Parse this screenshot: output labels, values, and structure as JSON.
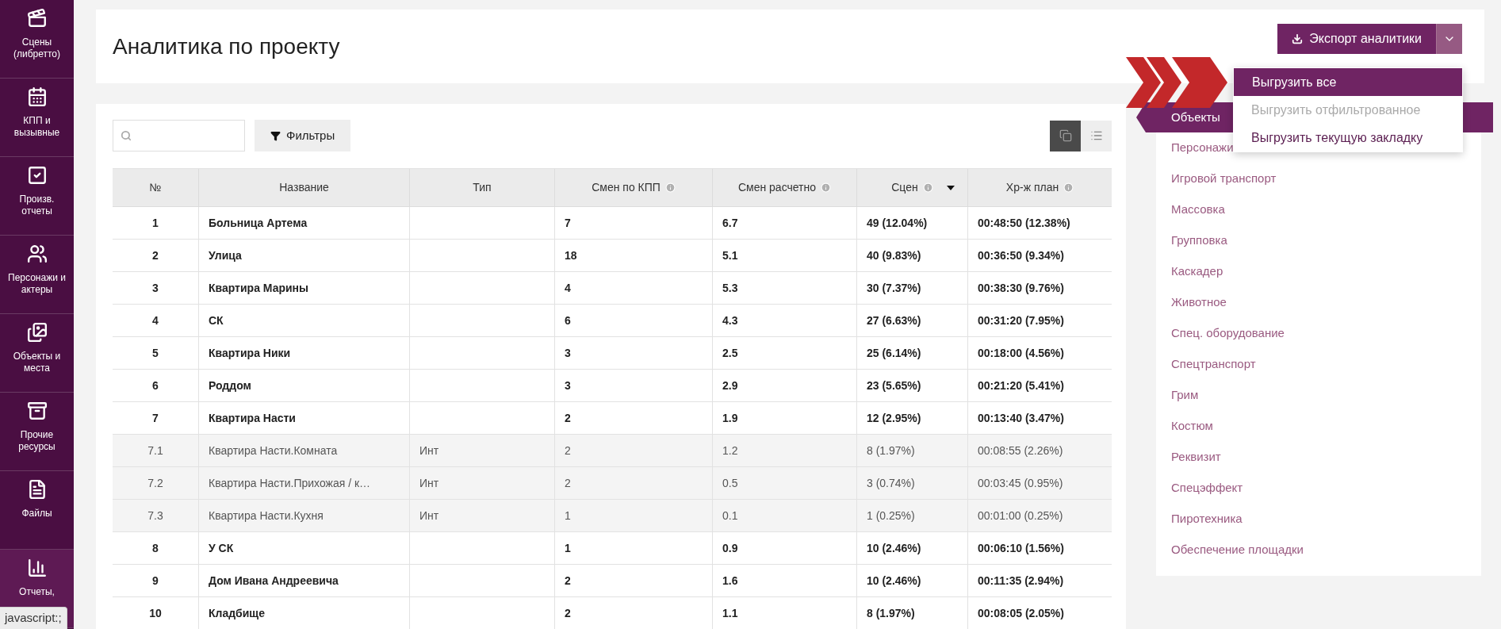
{
  "sidebar": {
    "items": [
      {
        "label": "Сцены (либретто)",
        "selected": false
      },
      {
        "label": "КПП и вызывные",
        "selected": false
      },
      {
        "label": "Произв. отчеты",
        "selected": false
      },
      {
        "label": "Персонажи и актеры",
        "selected": false
      },
      {
        "label": "Объекты и места",
        "selected": false
      },
      {
        "label": "Прочие ресурсы",
        "selected": false
      },
      {
        "label": "Файлы",
        "selected": false
      },
      {
        "label": "Отчеты,",
        "selected": true
      }
    ]
  },
  "header": {
    "title": "Аналитика по проекту",
    "export_button": "Экспорт аналитики"
  },
  "export_menu": {
    "items": [
      {
        "label": "Выгрузить все",
        "selected": true,
        "disabled": false
      },
      {
        "label": "Выгрузить отфильтрованное",
        "selected": false,
        "disabled": true
      },
      {
        "label": "Выгрузить текущую закладку",
        "selected": false,
        "disabled": false
      }
    ]
  },
  "toolbar": {
    "filter_button": "Фильтры",
    "view_toggle": [
      {
        "selected": true
      },
      {
        "selected": false
      }
    ]
  },
  "table": {
    "columns": [
      {
        "label": "№",
        "info": false,
        "sorted": false
      },
      {
        "label": "Название",
        "info": false,
        "sorted": false
      },
      {
        "label": "Тип",
        "info": false,
        "sorted": false
      },
      {
        "label": "Смен по КПП",
        "info": true,
        "sorted": false
      },
      {
        "label": "Смен расчетно",
        "info": true,
        "sorted": false
      },
      {
        "label": "Сцен",
        "info": true,
        "sorted": true
      },
      {
        "label": "Хр-ж план",
        "info": true,
        "sorted": false
      }
    ],
    "rows": [
      {
        "kind": "group",
        "cells": [
          "1",
          "Больница Артема",
          "",
          "7",
          "6.7",
          "49 (12.04%)",
          "00:48:50 (12.38%)"
        ]
      },
      {
        "kind": "group",
        "cells": [
          "2",
          "Улица",
          "",
          "18",
          "5.1",
          "40 (9.83%)",
          "00:36:50 (9.34%)"
        ]
      },
      {
        "kind": "group",
        "cells": [
          "3",
          "Квартира Марины",
          "",
          "4",
          "5.3",
          "30 (7.37%)",
          "00:38:30 (9.76%)"
        ]
      },
      {
        "kind": "group",
        "cells": [
          "4",
          "СК",
          "",
          "6",
          "4.3",
          "27 (6.63%)",
          "00:31:20 (7.95%)"
        ]
      },
      {
        "kind": "group",
        "cells": [
          "5",
          "Квартира Ники",
          "",
          "3",
          "2.5",
          "25 (6.14%)",
          "00:18:00 (4.56%)"
        ]
      },
      {
        "kind": "group",
        "cells": [
          "6",
          "Роддом",
          "",
          "3",
          "2.9",
          "23 (5.65%)",
          "00:21:20 (5.41%)"
        ]
      },
      {
        "kind": "group",
        "cells": [
          "7",
          "Квартира Насти",
          "",
          "2",
          "1.9",
          "12 (2.95%)",
          "00:13:40 (3.47%)"
        ]
      },
      {
        "kind": "sub",
        "cells": [
          "7.1",
          "Квартира Насти.Комната",
          "Инт",
          "2",
          "1.2",
          "8 (1.97%)",
          "00:08:55 (2.26%)"
        ]
      },
      {
        "kind": "sub",
        "cells": [
          "7.2",
          "Квартира Насти.Прихожая / к…",
          "Инт",
          "2",
          "0.5",
          "3 (0.74%)",
          "00:03:45 (0.95%)"
        ]
      },
      {
        "kind": "sub",
        "cells": [
          "7.3",
          "Квартира Насти.Кухня",
          "Инт",
          "1",
          "0.1",
          "1 (0.25%)",
          "00:01:00 (0.25%)"
        ]
      },
      {
        "kind": "group",
        "cells": [
          "8",
          "У СК",
          "",
          "1",
          "0.9",
          "10 (2.46%)",
          "00:06:10 (1.56%)"
        ]
      },
      {
        "kind": "group",
        "cells": [
          "9",
          "Дом Ивана Андреевича",
          "",
          "2",
          "1.6",
          "10 (2.46%)",
          "00:11:35 (2.94%)"
        ]
      },
      {
        "kind": "group",
        "cells": [
          "10",
          "Кладбище",
          "",
          "2",
          "1.1",
          "8 (1.97%)",
          "00:08:05 (2.05%)"
        ]
      }
    ]
  },
  "categories": {
    "items": [
      {
        "label": "Объекты",
        "selected": true
      },
      {
        "label": "Персонажи",
        "selected": false
      },
      {
        "label": "Игровой транспорт",
        "selected": false
      },
      {
        "label": "Массовка",
        "selected": false
      },
      {
        "label": "Групповка",
        "selected": false
      },
      {
        "label": "Каскадер",
        "selected": false
      },
      {
        "label": "Животное",
        "selected": false
      },
      {
        "label": "Спец. оборудование",
        "selected": false
      },
      {
        "label": "Спецтранспорт",
        "selected": false
      },
      {
        "label": "Грим",
        "selected": false
      },
      {
        "label": "Костюм",
        "selected": false
      },
      {
        "label": "Реквизит",
        "selected": false
      },
      {
        "label": "Спецэффект",
        "selected": false
      },
      {
        "label": "Пиротехника",
        "selected": false
      },
      {
        "label": "Обеспечение площадки",
        "selected": false
      }
    ]
  },
  "status_link": "javascript:;"
}
